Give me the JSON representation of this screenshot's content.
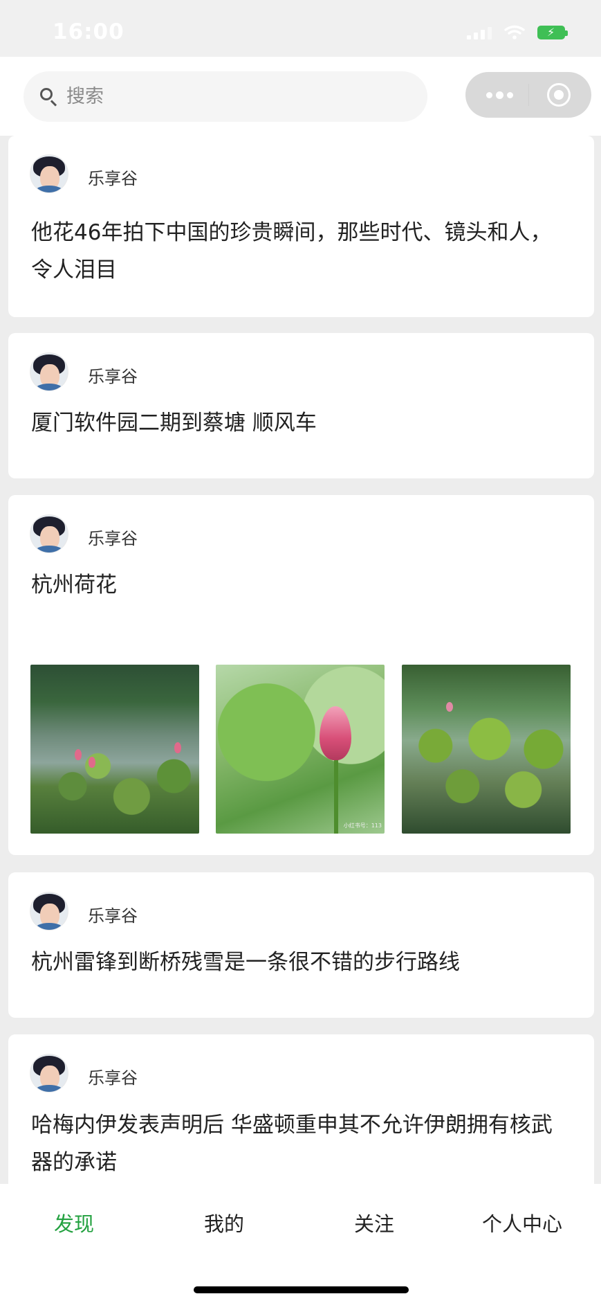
{
  "status_bar": {
    "time": "16:00"
  },
  "search": {
    "placeholder": "搜索"
  },
  "feed": [
    {
      "author": "乐享谷",
      "text": "他花46年拍下中国的珍贵瞬间，那些时代、镜头和人，令人泪目"
    },
    {
      "author": "乐享谷",
      "text": "厦门软件园二期到蔡塘 顺风车"
    },
    {
      "author": "乐享谷",
      "text": "杭州荷花",
      "images": [
        "lotus-pond-photo",
        "lotus-bud-photo",
        "lotus-leaves-photo"
      ],
      "image_watermark": "小红书号：113"
    },
    {
      "author": "乐享谷",
      "text": "杭州雷锋到断桥残雪是一条很不错的步行路线"
    },
    {
      "author": "乐享谷",
      "text": "哈梅内伊发表声明后 华盛顿重申其不允许伊朗拥有核武器的承诺"
    }
  ],
  "tabs": [
    {
      "label": "发现",
      "active": true
    },
    {
      "label": "我的",
      "active": false
    },
    {
      "label": "关注",
      "active": false
    },
    {
      "label": "个人中心",
      "active": false
    }
  ],
  "colors": {
    "accent": "#23a140",
    "page_bg": "#ededed",
    "card_bg": "#ffffff"
  }
}
